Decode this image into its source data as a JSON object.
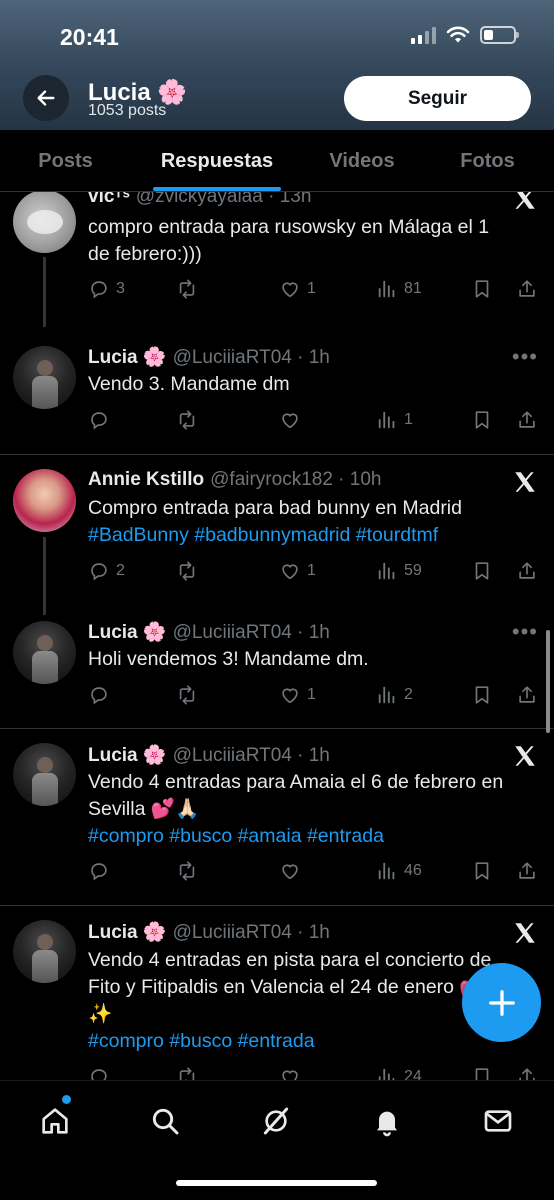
{
  "status_bar": {
    "time": "20:41"
  },
  "header": {
    "name": "Lucia 🌸",
    "posts_count": "1053 posts",
    "follow_label": "Seguir"
  },
  "tabs": [
    {
      "label": "Posts",
      "active": false
    },
    {
      "label": "Respuestas",
      "active": true
    },
    {
      "label": "Videos",
      "active": false
    },
    {
      "label": "Fotos",
      "active": false
    }
  ],
  "tweets": [
    {
      "name": "vicᵀˢ",
      "handle": "@zvickyayalaa",
      "time": "13h",
      "text_lines": [
        "compro entrada para rusowsky en Málaga el 1",
        "de febrero:)))"
      ],
      "replies": "3",
      "reposts": "",
      "likes": "1",
      "views": "81",
      "corner": "x-logo-icon"
    },
    {
      "name": "Lucia 🌸",
      "handle": "@LuciiiaRT04",
      "time": "1h",
      "text_lines": [
        "Vendo 3. Mandame dm"
      ],
      "replies": "",
      "reposts": "",
      "likes": "",
      "views": "1",
      "corner": "more-icon"
    },
    {
      "name": "Annie Kstillo",
      "handle": "@fairyrock182",
      "time": "10h",
      "text_lines": [
        "Compro entrada para bad bunny en Madrid"
      ],
      "hashtag_line": "#BadBunny #badbunnymadrid #tourdtmf",
      "replies": "2",
      "reposts": "",
      "likes": "1",
      "views": "59",
      "corner": "x-logo-icon"
    },
    {
      "name": "Lucia 🌸",
      "handle": "@LuciiiaRT04",
      "time": "1h",
      "text_lines": [
        "Holi vendemos 3! Mandame dm."
      ],
      "replies": "",
      "reposts": "",
      "likes": "1",
      "views": "2",
      "corner": "more-icon"
    },
    {
      "name": "Lucia 🌸",
      "handle": "@LuciiiaRT04",
      "time": "1h",
      "text_lines": [
        "Vendo 4 entradas para Amaia el 6 de febrero en",
        "Sevilla 💕🙏🏻"
      ],
      "hashtag_line": "#compro #busco #amaia #entrada",
      "replies": "",
      "reposts": "",
      "likes": "",
      "views": "46",
      "corner": "x-logo-icon"
    },
    {
      "name": "Lucia 🌸",
      "handle": "@LuciiiaRT04",
      "time": "1h",
      "text_lines": [
        "Vendo 4 entradas en pista para el concierto de",
        "Fito y Fitipaldis en Valencia el 24 de enero 💕",
        "✨"
      ],
      "hashtag_line": "#compro #busco #entrada",
      "replies": "",
      "reposts": "",
      "likes": "",
      "views": "24",
      "corner": "x-logo-icon"
    }
  ],
  "colors": {
    "accent": "#1d9bf0",
    "background": "#000000",
    "muted": "#71767b",
    "text": "#e7e9ea"
  },
  "bottom_nav": [
    "home-icon",
    "search-icon",
    "grok-icon",
    "notifications-icon",
    "messages-icon"
  ]
}
